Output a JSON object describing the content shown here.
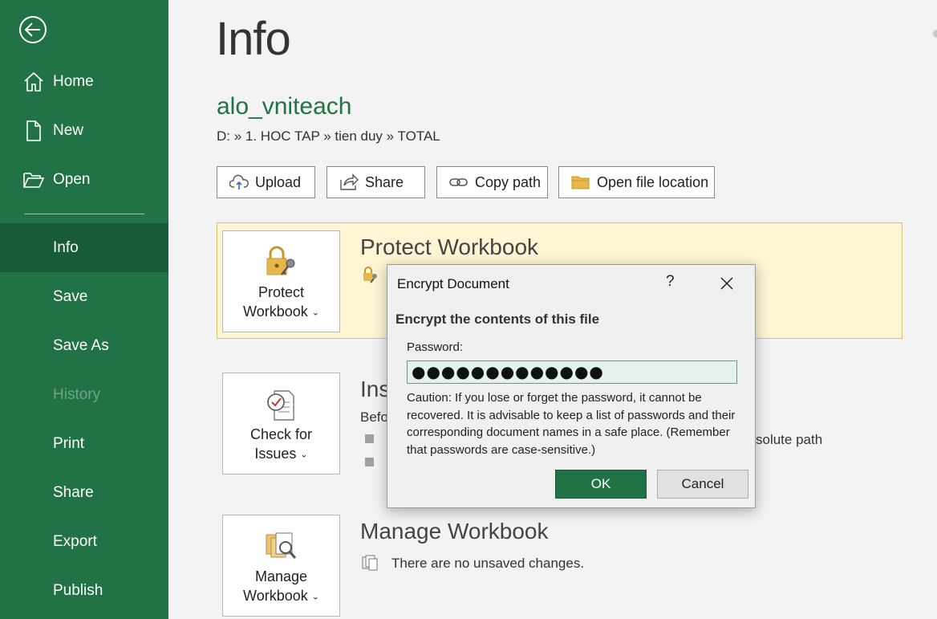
{
  "sidebar": {
    "items": [
      {
        "label": "Home"
      },
      {
        "label": "New"
      },
      {
        "label": "Open"
      },
      {
        "label": "Info"
      },
      {
        "label": "Save"
      },
      {
        "label": "Save As"
      },
      {
        "label": "History"
      },
      {
        "label": "Print"
      },
      {
        "label": "Share"
      },
      {
        "label": "Export"
      },
      {
        "label": "Publish"
      }
    ],
    "active": "Info",
    "disabled": "History"
  },
  "main": {
    "title": "Info",
    "file_name": "alo_vniteach",
    "path": "D: » 1. HOC TAP » tien duy » TOTAL",
    "actions": [
      {
        "label": "Upload",
        "icon": "cloud-upload-icon"
      },
      {
        "label": "Share",
        "icon": "share-arrow-icon"
      },
      {
        "label": "Copy path",
        "icon": "link-icon"
      },
      {
        "label": "Open file location",
        "icon": "folder-icon"
      }
    ],
    "protect": {
      "tile_line1": "Protect",
      "tile_line2": "Workbook",
      "title": "Protect Workbook"
    },
    "inspect": {
      "tile_line1": "Check for",
      "tile_line2": "Issues",
      "title_partial": "Ins",
      "desc_partial": "Befo",
      "bullet_tail": "solute path"
    },
    "manage": {
      "tile_line1": "Manage",
      "tile_line2": "Workbook",
      "title": "Manage Workbook",
      "status": "There are no unsaved changes."
    }
  },
  "dialog": {
    "title": "Encrypt Document",
    "help": "?",
    "heading": "Encrypt the contents of this file",
    "password_label": "Password:",
    "password_value": "●●●●●●●●●●●●●",
    "caution": "Caution: If you lose or forget the password, it cannot be recovered. It is advisable to keep a list of passwords and their corresponding document names in a safe place. (Remember that passwords are case-sensitive.)",
    "ok_label": "OK",
    "cancel_label": "Cancel"
  },
  "colors": {
    "sidebar": "#217346",
    "sidebar_active": "#185c37",
    "accent": "#217346",
    "protect_bg": "#fff4d4"
  }
}
